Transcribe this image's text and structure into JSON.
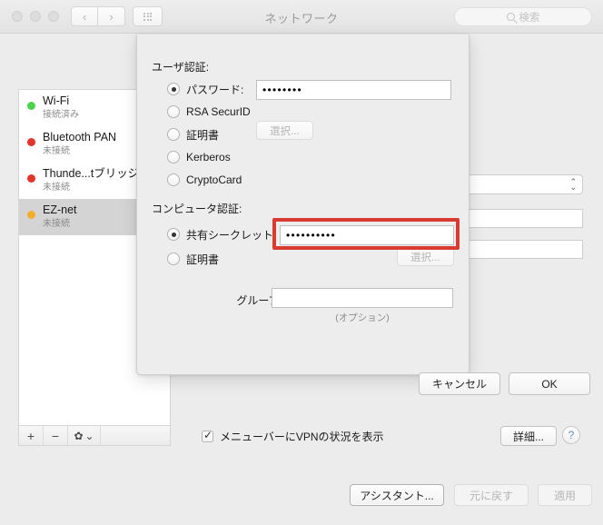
{
  "window": {
    "title": "ネットワーク",
    "traffic_lights": [
      "close",
      "minimize",
      "zoom"
    ],
    "nav_back": "‹",
    "nav_forward": "›",
    "search_placeholder": "検索"
  },
  "sidebar": {
    "services": [
      {
        "name": "Wi-Fi",
        "status": "接続済み",
        "dot_color": "#4cd34c",
        "selected": false
      },
      {
        "name": "Bluetooth PAN",
        "status": "未接続",
        "dot_color": "#e2342b",
        "selected": false
      },
      {
        "name": "Thunde...tブリッジ",
        "status": "未接続",
        "dot_color": "#e2342b",
        "selected": false
      },
      {
        "name": "EZ-net",
        "status": "未接続",
        "dot_color": "#f2ae28",
        "selected": true
      }
    ],
    "toolbar": {
      "add_label": "+",
      "remove_label": "−",
      "gear_label": "✿",
      "gear_chevron": "⌄"
    }
  },
  "main": {
    "show_vpn_status_label": "メニューバーにVPNの状況を表示",
    "show_vpn_status_checked": true,
    "detail_label": "詳細...",
    "help_label": "?",
    "assistant_label": "アシスタント...",
    "revert_label": "元に戻す",
    "apply_label": "適用"
  },
  "sheet": {
    "user_auth_title": "ユーザ認証:",
    "user_auth_options": [
      {
        "label": "パスワード:",
        "selected": true
      },
      {
        "label": "RSA SecurID",
        "selected": false
      },
      {
        "label": "証明書",
        "selected": false
      },
      {
        "label": "Kerberos",
        "selected": false
      },
      {
        "label": "CryptoCard",
        "selected": false
      }
    ],
    "password_value": "••••••••",
    "user_cert_select_label": "選択...",
    "machine_auth_title": "コンピュータ認証:",
    "machine_auth_options": [
      {
        "label": "共有シークレット:",
        "selected": true
      },
      {
        "label": "証明書",
        "selected": false
      }
    ],
    "shared_secret_value": "••••••••••",
    "machine_cert_select_label": "選択...",
    "group_name_label": "グループ名:",
    "group_name_value": "",
    "group_name_note": "(オプション)",
    "cancel_label": "キャンセル",
    "ok_label": "OK",
    "highlight_color": "#d93a32"
  }
}
